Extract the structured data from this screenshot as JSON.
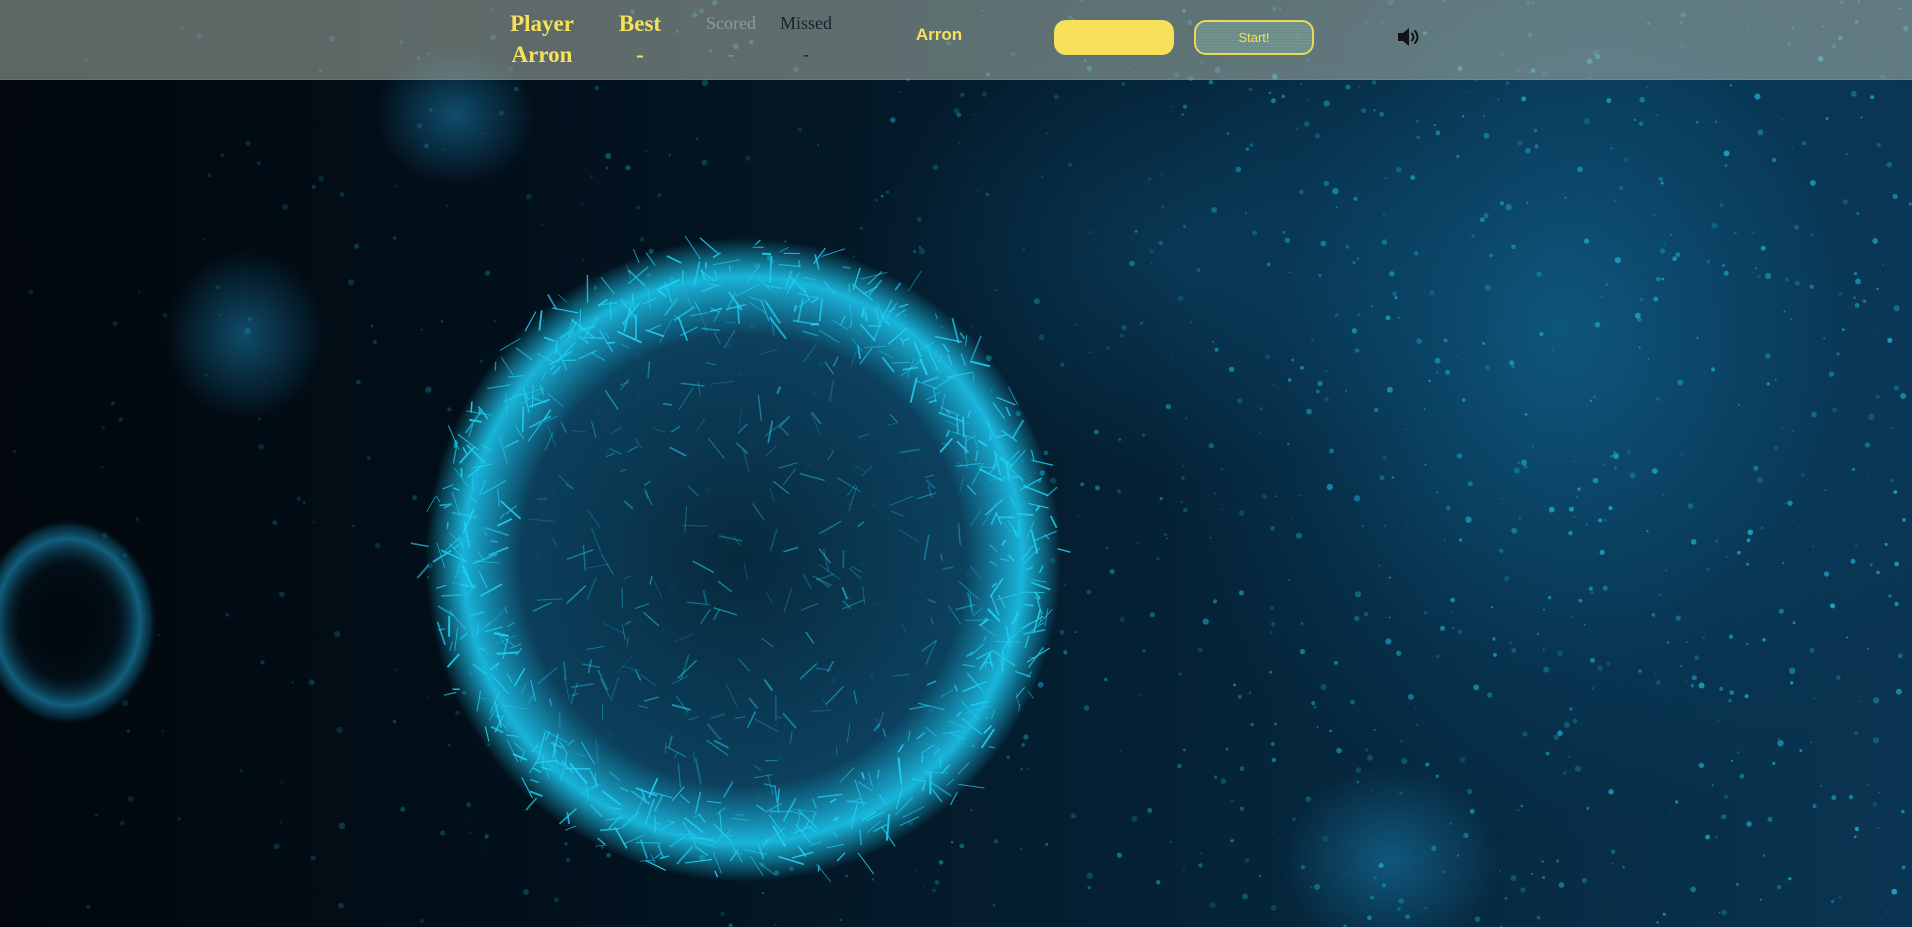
{
  "hud": {
    "player": {
      "label": "Player",
      "value": "Arron"
    },
    "best": {
      "label": "Best",
      "value": "-"
    },
    "scored": {
      "label": "Scored",
      "value": "-"
    },
    "missed": {
      "label": "Missed",
      "value": "-"
    },
    "current_player": "Arron",
    "name_input": {
      "value": ""
    },
    "start_button": "Start!",
    "sound_icon": "speaker-volume-icon"
  },
  "colors": {
    "accent": "#f7e05a",
    "hud_background": "#a9b4a9",
    "particle": "#1fd0f2"
  }
}
